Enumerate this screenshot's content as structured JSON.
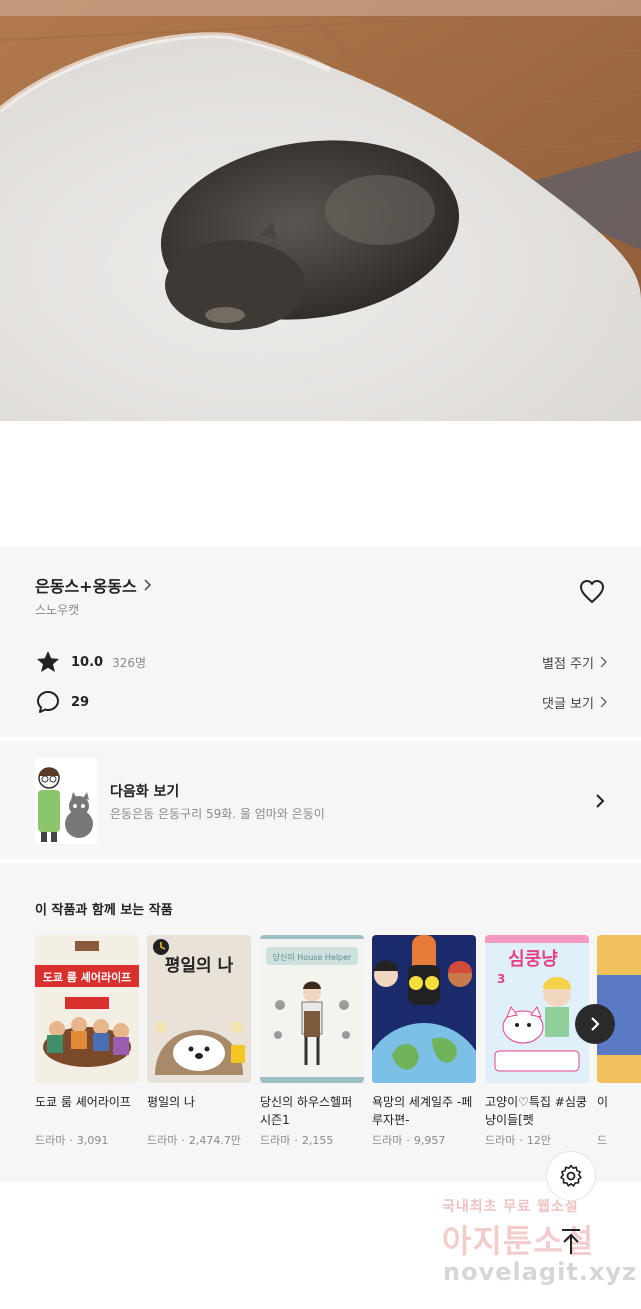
{
  "work": {
    "title": "은동스+옹동스",
    "author": "스노우캣"
  },
  "rating": {
    "score": "10.0",
    "count": "326명",
    "action_label": "별점 주기"
  },
  "comments": {
    "count": "29",
    "action_label": "댓글 보기"
  },
  "next_episode": {
    "label": "다음화 보기",
    "description": "은동은동 은동구리 59화. 울 엄마와 은동이"
  },
  "recommendations": {
    "heading": "이 작품과 함께 보는 작품",
    "items": [
      {
        "title": "도쿄 룸 셰어라이프",
        "genre": "드라마",
        "views": "3,091",
        "cover_text": "도쿄 룸 셰어라이프"
      },
      {
        "title": "평일의 나",
        "genre": "드라마",
        "views": "2,474.7만",
        "cover_text": "평일의 나"
      },
      {
        "title": "당신의 하우스헬퍼 시즌1",
        "genre": "드라마",
        "views": "2,155",
        "cover_text": "당신의 House Helper"
      },
      {
        "title": "욕망의 세계일주 -페루자편-",
        "genre": "드라마",
        "views": "9,957",
        "cover_text": ""
      },
      {
        "title": "고양이♡특집 #심쿵냥이들[펫",
        "genre": "드라마",
        "views": "12만",
        "cover_text": "심쿵냥"
      },
      {
        "title": "이",
        "genre": "드",
        "views": "",
        "cover_text": ""
      }
    ]
  },
  "watermark": {
    "line1": "국내최초 무료 웹소설",
    "line2": "아지툰소설",
    "line3": "novelagit.xyz"
  },
  "icons": {
    "author_chevron": "chevron-right-icon",
    "favorite": "heart-outline-icon",
    "rating": "star-icon",
    "comments": "speech-bubble-icon",
    "settings": "gear-icon",
    "scroll_top": "arrow-up-icon"
  },
  "colors": {
    "page_bg": "#ffffff",
    "card_bg": "#f6f6f6",
    "text_primary": "#222222",
    "text_secondary": "#8a8a8a"
  }
}
